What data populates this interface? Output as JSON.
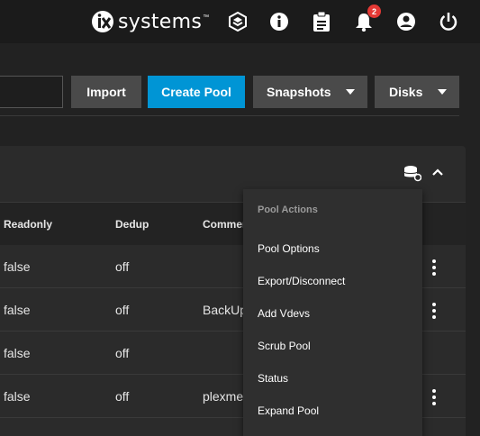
{
  "header": {
    "logo_text": "systems",
    "logo_tm": "™",
    "notification_count": "2",
    "icons": [
      "truecommand-icon",
      "info-icon",
      "clipboard-icon",
      "bell-icon",
      "account-icon",
      "power-icon"
    ]
  },
  "toolbar": {
    "search_value": "",
    "import_label": "Import",
    "create_pool_label": "Create Pool",
    "snapshots_label": "Snapshots",
    "disks_label": "Disks"
  },
  "table": {
    "columns": [
      "Readonly",
      "Dedup",
      "Commer"
    ],
    "rows": [
      {
        "readonly": "false",
        "dedup": "off",
        "comments": ""
      },
      {
        "readonly": "false",
        "dedup": "off",
        "comments": "BackUp"
      },
      {
        "readonly": "false",
        "dedup": "off",
        "comments": ""
      },
      {
        "readonly": "false",
        "dedup": "off",
        "comments": "plexme"
      }
    ]
  },
  "pool_menu": {
    "header": "Pool Actions",
    "items": [
      "Pool Options",
      "Export/Disconnect",
      "Add Vdevs",
      "Scrub Pool",
      "Status",
      "Expand Pool"
    ]
  },
  "colors": {
    "accent": "#0095d5",
    "badge": "#e53935",
    "background": "#222222",
    "card": "#2b2b2b",
    "menu": "#2f2f2f"
  }
}
